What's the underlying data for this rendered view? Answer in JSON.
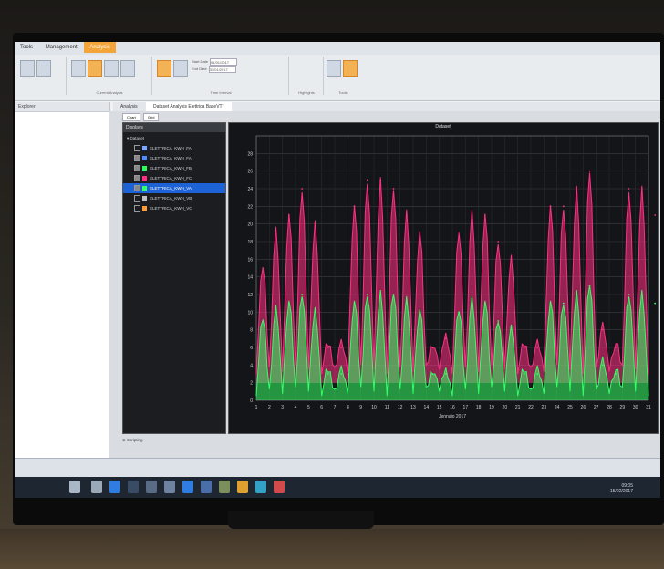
{
  "ribbon": {
    "tabs": [
      "Tools",
      "Management",
      "Analysis"
    ],
    "active_tab": "Analysis",
    "groups": [
      "Current Analysis",
      "Time Interval",
      "Highlights",
      "Tools"
    ],
    "fields": [
      {
        "label": "Start Date",
        "value": "01/01/2017"
      },
      {
        "label": "End Date",
        "value": "31/01/2017"
      }
    ]
  },
  "left_pane": {
    "header": "Explorer"
  },
  "doc_tabs": [
    "Analysis",
    "Dataset Analysis Elettrica BaseVT*"
  ],
  "views": [
    "Chart",
    "Grid"
  ],
  "displays": {
    "title": "Displays",
    "root": "Dataset",
    "items": [
      {
        "label": "ELETTRICA_KWH_FA",
        "checked": false,
        "color": "#7aa7ff"
      },
      {
        "label": "ELETTRICA_KWH_FA",
        "checked": true,
        "color": "#4f8cff"
      },
      {
        "label": "ELETTRICA_KWH_FB",
        "checked": true,
        "color": "#2bff5a"
      },
      {
        "label": "ELETTRICA_KWH_FC",
        "checked": true,
        "color": "#ff2f84"
      },
      {
        "label": "ELETTRICA_KWH_VA",
        "checked": true,
        "color": "#33ff66",
        "selected": true
      },
      {
        "label": "ELETTRICA_KWH_VB",
        "checked": false,
        "color": "#c0c0c0"
      },
      {
        "label": "ELETTRICA_KWH_VC",
        "checked": false,
        "color": "#ff9b38"
      }
    ]
  },
  "scripting_label": "Scripting",
  "chart_data": {
    "type": "line",
    "title": "Dataset",
    "xlabel": "Jennaio 2017",
    "ylabel": "",
    "x": [
      1,
      2,
      3,
      4,
      5,
      6,
      7,
      8,
      9,
      10,
      11,
      12,
      13,
      14,
      15,
      16,
      17,
      18,
      19,
      20,
      21,
      22,
      23,
      24,
      25,
      26,
      27,
      28,
      29,
      30,
      31
    ],
    "ylim": [
      0,
      30
    ],
    "yticks": [
      0,
      2,
      4,
      6,
      8,
      10,
      12,
      14,
      16,
      18,
      20,
      22,
      24,
      26,
      28
    ],
    "grid": true,
    "series": [
      {
        "color": "#ff2f84",
        "values": [
          15,
          19,
          21,
          24,
          20,
          6,
          6,
          22,
          25,
          25,
          24,
          21,
          19,
          6,
          7,
          19,
          21,
          21,
          18,
          16,
          6,
          6,
          22,
          22,
          24,
          26,
          8,
          6,
          24,
          24,
          21
        ]
      },
      {
        "color": "#33ff66",
        "values": [
          9,
          10,
          11,
          12,
          10,
          3,
          3,
          11,
          12,
          12,
          12,
          11,
          10,
          3,
          3,
          10,
          11,
          11,
          9,
          8,
          3,
          3,
          11,
          11,
          12,
          13,
          4,
          3,
          12,
          12,
          11
        ]
      }
    ]
  },
  "taskbar": {
    "time": "09:05",
    "date": "15/02/2017"
  }
}
